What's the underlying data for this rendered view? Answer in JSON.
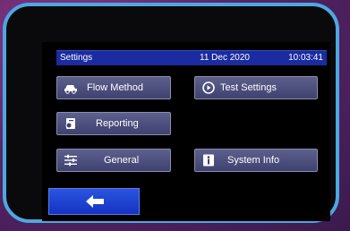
{
  "header": {
    "title": "Settings",
    "date": "11 Dec 2020",
    "time": "10:03:41"
  },
  "buttons": {
    "flow_method": "Flow Method",
    "test_settings": "Test Settings",
    "reporting": "Reporting",
    "general": "General",
    "system_info": "System Info"
  },
  "icons": {
    "flow_method": "car-icon",
    "test_settings": "play-circle-icon",
    "reporting": "report-icon",
    "general": "sliders-icon",
    "system_info": "info-icon",
    "back": "arrow-left-icon"
  },
  "colors": {
    "bezel": "#4ca8e0",
    "header": "#1a2ca0",
    "button": "#4d4f80",
    "back_button": "#1f44d0"
  }
}
